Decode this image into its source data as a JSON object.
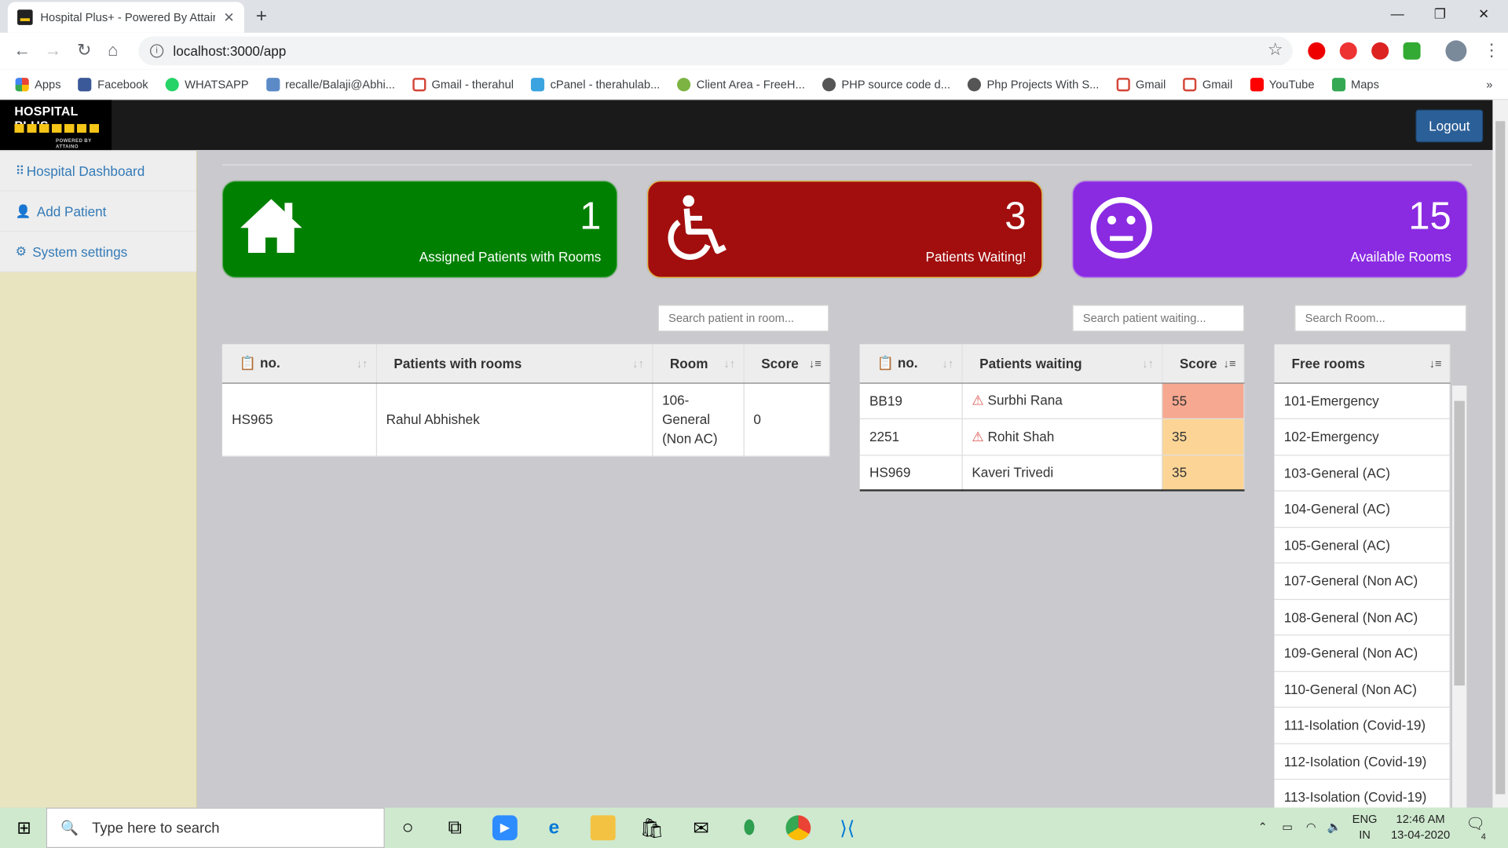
{
  "browser": {
    "tab_title": "Hospital Plus+ - Powered By Attaino",
    "url": "localhost:3000/app",
    "bookmarks": [
      "Apps",
      "Facebook",
      "WHATSAPP",
      "recalle/Balaji@Abhi...",
      "Gmail - therahul",
      "cPanel - therahulab...",
      "Client Area - FreeH...",
      "PHP source code d...",
      "Php Projects With S...",
      "Gmail",
      "Gmail",
      "YouTube",
      "Maps"
    ]
  },
  "header": {
    "logo_text": "HOSPITAL PLUS",
    "logo_sub": "POWERED BY ATTAINO",
    "logout_label": "Logout"
  },
  "sidebar": {
    "items": [
      {
        "label": "Hospital Dashboard"
      },
      {
        "label": "Add Patient"
      },
      {
        "label": "System settings"
      }
    ]
  },
  "cards": [
    {
      "value": "1",
      "label": "Assigned Patients with Rooms",
      "color": "#008000"
    },
    {
      "value": "3",
      "label": "Patients Waiting!",
      "color": "#a20e0e"
    },
    {
      "value": "15",
      "label": "Available Rooms",
      "color": "#8a2be2"
    }
  ],
  "search": {
    "room_placeholder": "Search patient in room...",
    "waiting_placeholder": "Search patient waiting...",
    "free_placeholder": "Search Room..."
  },
  "rooms_table": {
    "headers": [
      "no.",
      "Patients with rooms",
      "Room",
      "Score"
    ],
    "rows": [
      {
        "no": "HS965",
        "name": "Rahul Abhishek",
        "room": "106-General (Non AC)",
        "score": "0"
      }
    ]
  },
  "waiting_table": {
    "headers": [
      "no.",
      "Patients waiting",
      "Score"
    ],
    "rows": [
      {
        "no": "BB19",
        "name": "Surbhi Rana",
        "score": "55",
        "warning": true,
        "color": "#f7a890"
      },
      {
        "no": "2251",
        "name": "Rohit Shah",
        "score": "35",
        "warning": true,
        "color": "#fcd596"
      },
      {
        "no": "HS969",
        "name": "Kaveri Trivedi",
        "score": "35",
        "warning": false,
        "color": "#fcd596"
      }
    ]
  },
  "free_table": {
    "header": "Free rooms",
    "rooms": [
      "101-Emergency",
      "102-Emergency",
      "103-General (AC)",
      "104-General (AC)",
      "105-General (AC)",
      "107-General (Non AC)",
      "108-General (Non AC)",
      "109-General (Non AC)",
      "110-General (Non AC)",
      "111-Isolation (Covid-19)",
      "112-Isolation (Covid-19)",
      "113-Isolation (Covid-19)"
    ]
  },
  "taskbar": {
    "search_placeholder": "Type here to search",
    "lang": "ENG",
    "region": "IN",
    "time": "12:46 AM",
    "date": "13-04-2020",
    "notifications": "4"
  }
}
